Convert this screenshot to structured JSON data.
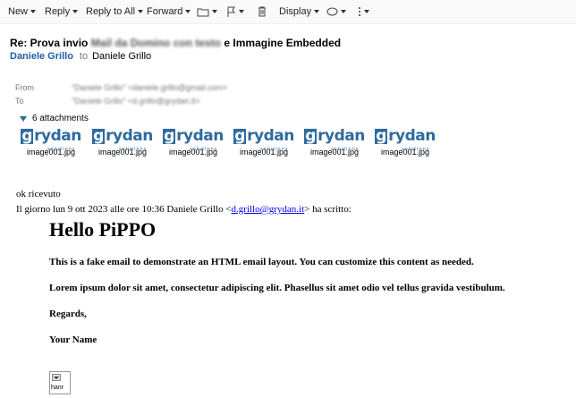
{
  "toolbar": {
    "new": "New",
    "reply": "Reply",
    "reply_all": "Reply to All",
    "forward": "Forward",
    "display": "Display"
  },
  "message": {
    "subject_start": "Re: Prova invio",
    "subject_blurred": "Mail da Domino con testo",
    "subject_end": "e Immagine Embedded",
    "sender": "Daniele Grillo",
    "to_word": "to",
    "recipient": "Daniele Grillo",
    "from_label": "From",
    "from_value": "\"Daniele Grillo\" <daniele.grillo@gmail.com>",
    "to_label": "To",
    "to_value": "\"Daniele Grillo\" <d.grillo@grydan.it>"
  },
  "attachments": {
    "count_label": "6 attachments",
    "logo_rest": "rydan",
    "logo_first": "g",
    "logo_sub": "solutions",
    "items": [
      {
        "name": "image001.jpg"
      },
      {
        "name": "image001.jpg"
      },
      {
        "name": "image001.jpg"
      },
      {
        "name": "image001.jpg"
      },
      {
        "name": "image001.jpg"
      },
      {
        "name": "image001.jpg"
      }
    ]
  },
  "body": {
    "reply_text": "ok ricevuto",
    "quote_prefix": "Il giorno lun 9 ott 2023 alle ore 10:36 Daniele Grillo <",
    "quote_email": "d.grillo@grydan.it",
    "quote_suffix": "> ha scritto:",
    "heading": "Hello PiPPO",
    "para1": "This is a fake email to demonstrate an HTML email layout. You can customize this content as needed.",
    "para2": "Lorem ipsum dolor sit amet, consectetur adipiscing elit. Phasellus sit amet odio vel tellus gravida vestibulum.",
    "regards": "Regards,",
    "name": "Your Name",
    "img_label": "hanr"
  }
}
